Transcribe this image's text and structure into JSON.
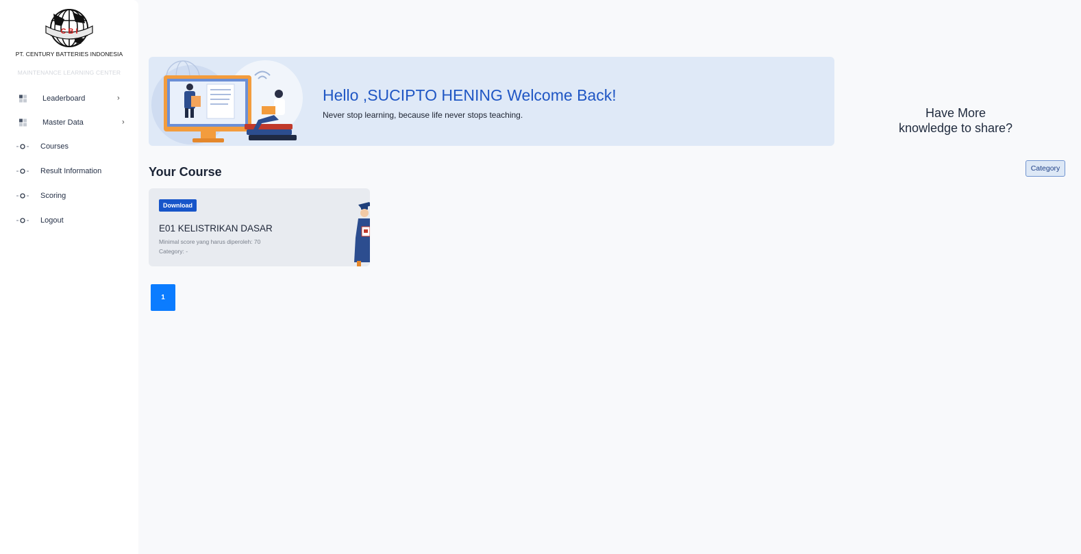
{
  "sidebar": {
    "logo_letters": "C B I",
    "company_name": "PT. CENTURY BATTERIES INDONESIA",
    "app_subtitle": "MAINTENANCE LEARNING CENTER",
    "items": [
      {
        "label": "Leaderboard",
        "icon": "grid-icon",
        "has_chevron": true
      },
      {
        "label": "Master Data",
        "icon": "grid-icon",
        "has_chevron": true
      },
      {
        "label": "Courses",
        "icon": "circle-dot-icon",
        "has_chevron": false
      },
      {
        "label": "Result Information",
        "icon": "circle-dot-icon",
        "has_chevron": false
      },
      {
        "label": "Scoring",
        "icon": "circle-dot-icon",
        "has_chevron": false
      },
      {
        "label": "Logout",
        "icon": "circle-dot-icon",
        "has_chevron": false
      }
    ],
    "chevron": "›"
  },
  "banner": {
    "greeting": "Hello ,SUCIPTO HENING Welcome Back!",
    "subtitle": "Never stop learning, because life never stops teaching."
  },
  "share": {
    "line1": "Have More",
    "line2": "knowledge to share?"
  },
  "courses_section": {
    "title": "Your Course",
    "category_button": "Category",
    "cards": [
      {
        "badge": "Download",
        "title": "E01 KELISTRIKAN DASAR",
        "min_score": "Minimal score yang harus diperoleh: 70",
        "category": "Category: -"
      }
    ]
  },
  "pagination": {
    "current_page": "1"
  },
  "colors": {
    "accent_blue": "#1f56c4",
    "badge_blue": "#1755c9",
    "page_button_blue": "#0b7cff",
    "banner_bg": "#dfe9f7"
  }
}
